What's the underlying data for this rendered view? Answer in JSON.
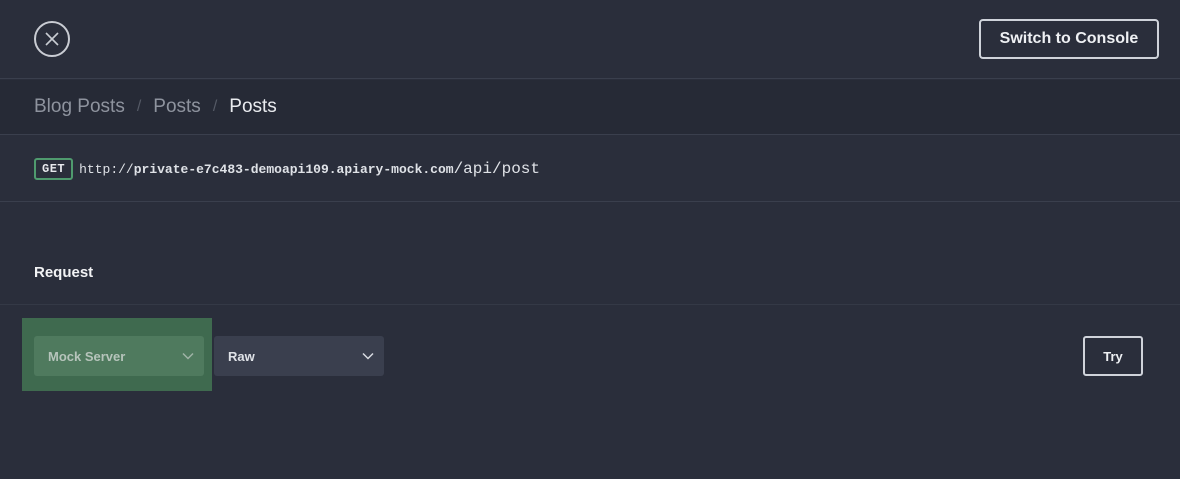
{
  "header": {
    "close_icon": "close-icon",
    "switch_label": "Switch to Console"
  },
  "breadcrumb": {
    "items": [
      "Blog Posts",
      "Posts"
    ],
    "current": "Posts",
    "separator": "/"
  },
  "endpoint": {
    "method": "GET",
    "url_protocol": "http://",
    "url_host": "private-e7c483-demoapi109.apiary-mock.com",
    "url_path": "/api/post"
  },
  "request": {
    "heading": "Request",
    "server_select": {
      "value": "Mock Server",
      "icon": "chevron-down-icon"
    },
    "format_select": {
      "value": "Raw",
      "icon": "chevron-down-icon"
    },
    "try_label": "Try"
  },
  "colors": {
    "background": "#2a2e3b",
    "highlight": "#3f6a4f",
    "method_border": "#4f9a6e"
  }
}
